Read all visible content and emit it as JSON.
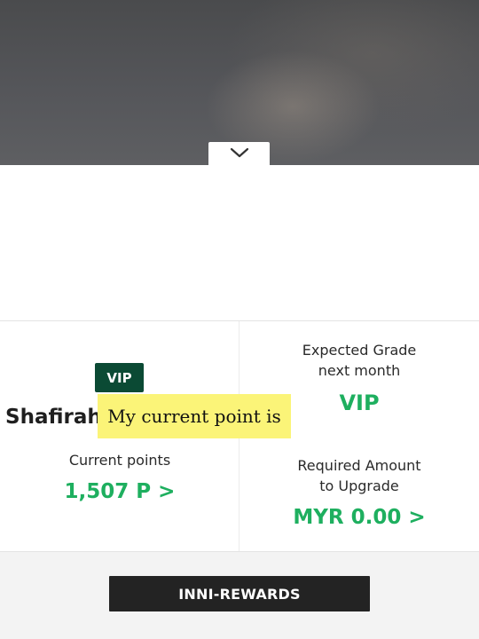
{
  "header": {
    "collapse_icon": "chevron-down-icon"
  },
  "member": {
    "badge": "VIP",
    "name": "Shafirah"
  },
  "caption": {
    "text": "My current point is"
  },
  "points": {
    "label": "Current points",
    "value": "1,507 P >"
  },
  "expected_grade": {
    "label_line1": "Expected Grade",
    "label_line2": "next month",
    "value": "VIP"
  },
  "upgrade": {
    "label_line1": "Required Amount",
    "label_line2": "to Upgrade",
    "value": "MYR 0.00 >"
  },
  "footer": {
    "button_label": "INNI-REWARDS"
  },
  "colors": {
    "accent_green": "#1eaf5f",
    "badge_green": "#0b4a34",
    "caption_yellow": "#fbf478",
    "button_dark": "#232323"
  }
}
